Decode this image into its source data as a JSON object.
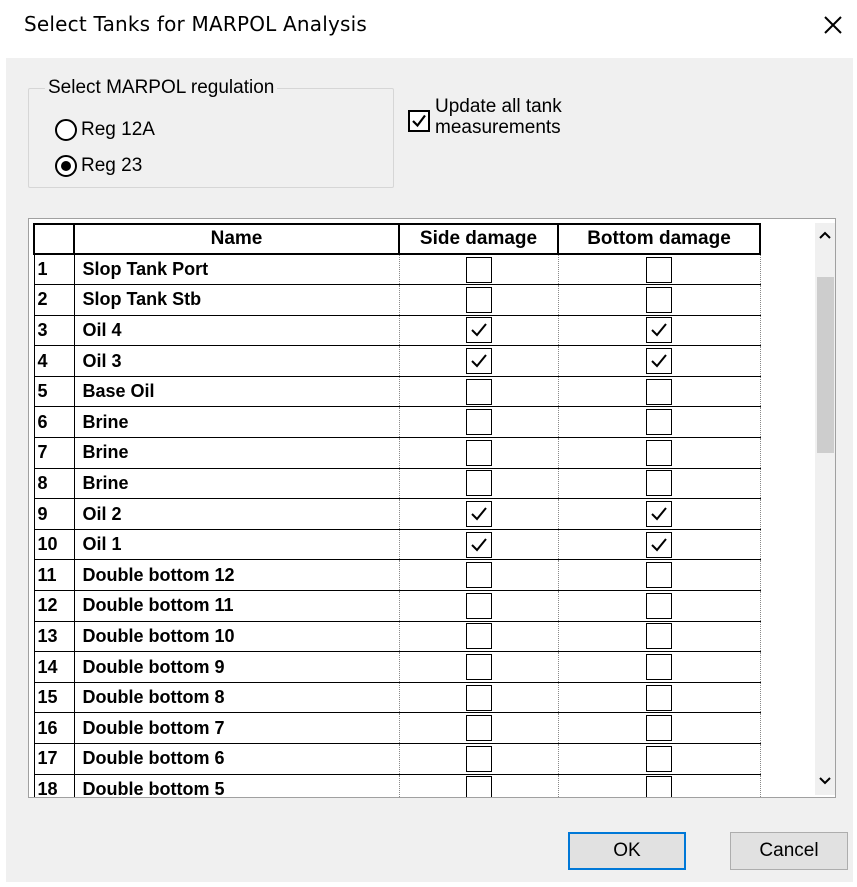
{
  "window": {
    "title": "Select Tanks for MARPOL Analysis",
    "close_icon": "close-icon"
  },
  "regulation": {
    "group_label": "Select MARPOL regulation",
    "options": [
      {
        "label": "Reg 12A",
        "selected": false
      },
      {
        "label": "Reg 23",
        "selected": true
      }
    ]
  },
  "update_all": {
    "label": "Update all tank measurements",
    "checked": true
  },
  "grid": {
    "columns": [
      "",
      "Name",
      "Side damage",
      "Bottom damage"
    ],
    "rows": [
      {
        "num": "1",
        "name": "Slop Tank Port",
        "side": false,
        "bottom": false
      },
      {
        "num": "2",
        "name": "Slop Tank Stb",
        "side": false,
        "bottom": false
      },
      {
        "num": "3",
        "name": "Oil 4",
        "side": true,
        "bottom": true
      },
      {
        "num": "4",
        "name": "Oil 3",
        "side": true,
        "bottom": true
      },
      {
        "num": "5",
        "name": "Base Oil",
        "side": false,
        "bottom": false
      },
      {
        "num": "6",
        "name": "Brine",
        "side": false,
        "bottom": false
      },
      {
        "num": "7",
        "name": "Brine",
        "side": false,
        "bottom": false
      },
      {
        "num": "8",
        "name": "Brine",
        "side": false,
        "bottom": false
      },
      {
        "num": "9",
        "name": "Oil 2",
        "side": true,
        "bottom": true
      },
      {
        "num": "10",
        "name": "Oil 1",
        "side": true,
        "bottom": true
      },
      {
        "num": "11",
        "name": "Double bottom 12",
        "side": false,
        "bottom": false
      },
      {
        "num": "12",
        "name": "Double bottom 11",
        "side": false,
        "bottom": false
      },
      {
        "num": "13",
        "name": "Double bottom 10",
        "side": false,
        "bottom": false
      },
      {
        "num": "14",
        "name": "Double bottom 9",
        "side": false,
        "bottom": false
      },
      {
        "num": "15",
        "name": "Double bottom 8",
        "side": false,
        "bottom": false
      },
      {
        "num": "16",
        "name": "Double bottom 7",
        "side": false,
        "bottom": false
      },
      {
        "num": "17",
        "name": "Double bottom 6",
        "side": false,
        "bottom": false
      },
      {
        "num": "18",
        "name": "Double bottom 5",
        "side": false,
        "bottom": false
      }
    ]
  },
  "buttons": {
    "ok": "OK",
    "cancel": "Cancel"
  },
  "colors": {
    "default_button_border": "#0078d7",
    "dialog_bg": "#f0f0f0"
  }
}
